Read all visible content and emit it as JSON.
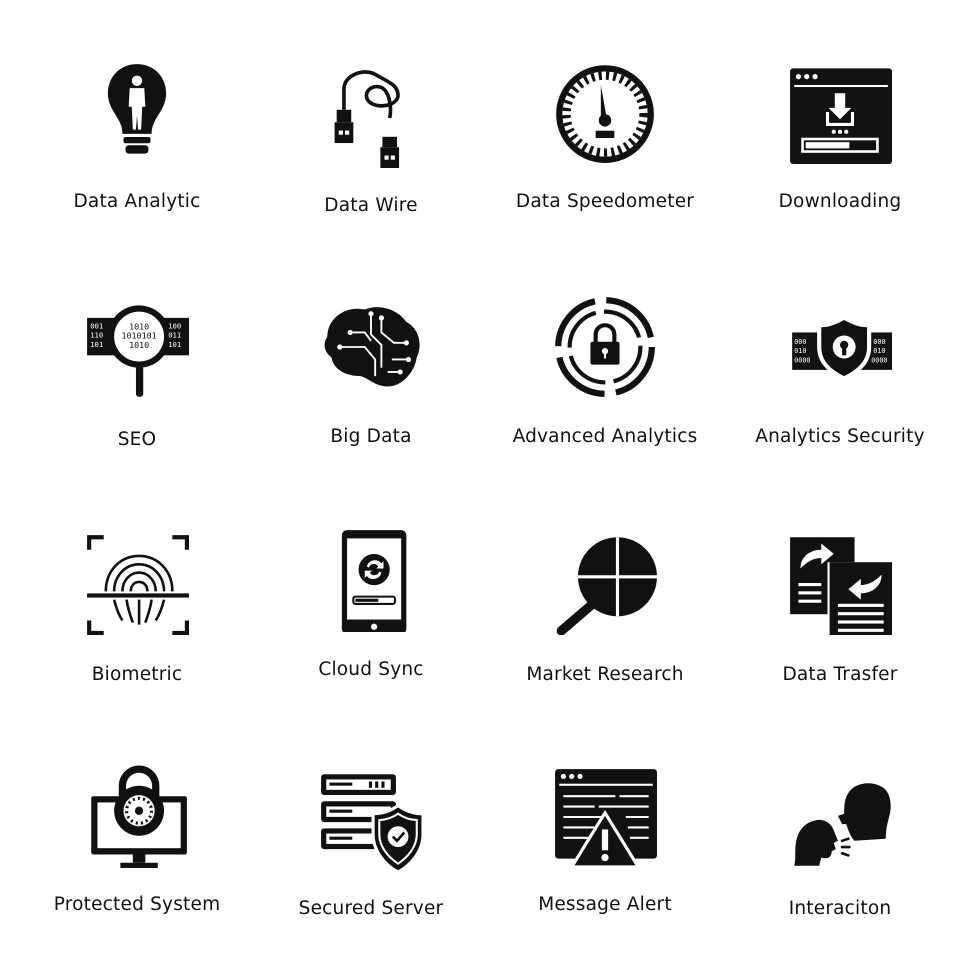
{
  "icons": [
    {
      "label": "Data Analytic",
      "icon": "lightbulb-person-icon"
    },
    {
      "label": "Data Wire",
      "icon": "usb-cable-icon"
    },
    {
      "label": "Data Speedometer",
      "icon": "speedometer-icon"
    },
    {
      "label": "Downloading",
      "icon": "browser-download-icon"
    },
    {
      "label": "SEO",
      "icon": "binary-magnifier-icon"
    },
    {
      "label": "Big Data",
      "icon": "circuit-brain-icon"
    },
    {
      "label": "Advanced Analytics",
      "icon": "target-lock-icon"
    },
    {
      "label": "Analytics Security",
      "icon": "shield-lock-binary-icon"
    },
    {
      "label": "Biometric",
      "icon": "fingerprint-scan-icon"
    },
    {
      "label": "Cloud Sync",
      "icon": "smartphone-sync-icon"
    },
    {
      "label": "Market Research",
      "icon": "pie-magnifier-icon"
    },
    {
      "label": "Data Trasfer",
      "icon": "document-transfer-icon"
    },
    {
      "label": "Protected System",
      "icon": "monitor-combination-lock-icon"
    },
    {
      "label": "Secured Server",
      "icon": "server-shield-icon"
    },
    {
      "label": "Message Alert",
      "icon": "browser-warning-icon"
    },
    {
      "label": "Interaciton",
      "icon": "two-heads-talking-icon"
    }
  ]
}
